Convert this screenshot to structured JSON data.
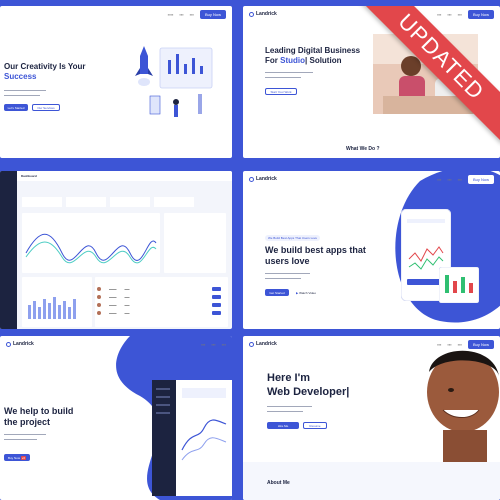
{
  "badge": "UPDATED",
  "colors": {
    "brand": "#3d55d6",
    "ribbon": "#e2474b",
    "dark": "#1c2340"
  },
  "card1": {
    "title_line1": "Our Creativity Is Your",
    "title_accent": "Success",
    "primary_btn": "Let's Started",
    "secondary_btn": "Our Services",
    "nav_cta": "Buy Now"
  },
  "card2": {
    "logo": "Landrick",
    "title_line1": "Leading Digital Business",
    "title_line2_prefix": "For",
    "title_accent": "Studio",
    "title_line2_suffix": "| Solution",
    "btn": "Start Your Work",
    "section": "What We Do ?",
    "nav_cta": "Buy Now"
  },
  "card3": {
    "page": "Dashboard"
  },
  "card4": {
    "logo": "Landrick",
    "tag": "We Build Best Apps That Users Love",
    "title_line1": "We build best apps that",
    "title_line2": "users love",
    "btn_primary": "Get Started",
    "btn_video": "Watch Video",
    "nav_cta": "Buy Now"
  },
  "card5": {
    "logo": "Landrick",
    "title_line1": "We help to build",
    "title_line2": "the project",
    "btn": "Buy Now",
    "btn_badge": "v2"
  },
  "card6": {
    "logo": "Landrick",
    "title_line1": "Here I'm",
    "title_line2": "Web Developer|",
    "btn_primary": "Hire Me",
    "btn_secondary": "Resume",
    "section": "About Me",
    "nav_cta": "Buy Now"
  }
}
